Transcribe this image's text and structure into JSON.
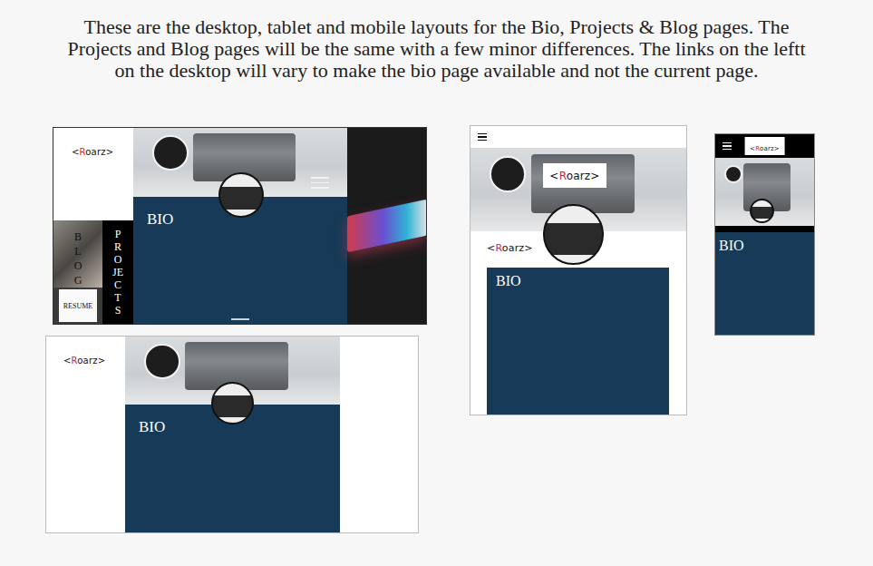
{
  "heading": "These are the desktop, tablet and mobile layouts for the Bio, Projects & Blog pages. The Projects and Blog pages will be the same with a few minor differences. The links on the leftt on the desktop will vary to make the bio page available and not the current page.",
  "logo": {
    "prefix": "<",
    "accent": "R",
    "rest": "oarz",
    "suffix": ">"
  },
  "desktop_nav": [
    {
      "label": "BLOG",
      "kind": "photo-tile"
    },
    {
      "label": "PROJECTS",
      "kind": "vertical-strip"
    },
    {
      "label": "RESUME",
      "kind": "paper-tile"
    }
  ],
  "page_title": "BIO"
}
